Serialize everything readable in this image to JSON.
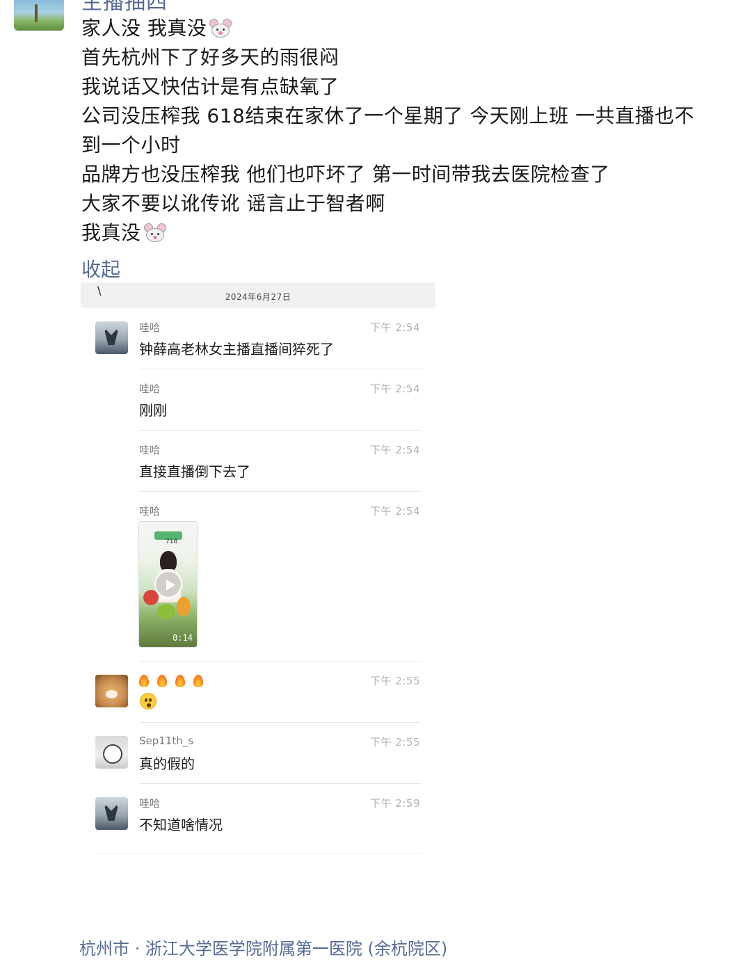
{
  "post": {
    "author": "主播抽四",
    "lines": [
      "家人没 我真没",
      "首先杭州下了好多天的雨很闷",
      "我说话又快估计是有点缺氧了",
      "公司没压榨我 618结束在家休了一个星期了  今天刚上班 一共直播也不",
      "到一个小时",
      "品牌方也没压榨我 他们也吓坏了 第一时间带我去医院检查了",
      "大家不要以讹传讹 谣言止于智者啊",
      "我真没"
    ],
    "collapse_label": "收起",
    "location": "杭州市 · 浙江大学医学院附属第一医院 (余杭院区)"
  },
  "chat_screenshot": {
    "back_glyph": "\\",
    "date": "2024年6月27日",
    "messages": [
      {
        "sender": "哇哈",
        "time": "下午 2:54",
        "text": "钟薛高老林女主播直播间猝死了"
      },
      {
        "sender": "哇哈",
        "time": "下午 2:54",
        "text": "刚刚"
      },
      {
        "sender": "哇哈",
        "time": "下午 2:54",
        "text": "直接直播倒下去了"
      },
      {
        "sender": "哇哈",
        "time": "下午 2:54",
        "video_duration": "0:14",
        "video_tag": "718"
      },
      {
        "sender": "",
        "time": "下午 2:55",
        "emoji": [
          "fire-icon",
          "fire-icon",
          "fire-icon",
          "fire-icon",
          "shocked-face-icon"
        ]
      },
      {
        "sender": "Sep11th_s",
        "time": "下午 2:55",
        "text": "真的假的"
      },
      {
        "sender": "哇哈",
        "time": "下午 2:59",
        "text": "不知道啥情况"
      }
    ]
  },
  "colors": {
    "link_blue": "#576b95",
    "text_dark": "#191919",
    "time_gray": "#b2b2b2",
    "sender_gray": "#7a7a7a"
  }
}
